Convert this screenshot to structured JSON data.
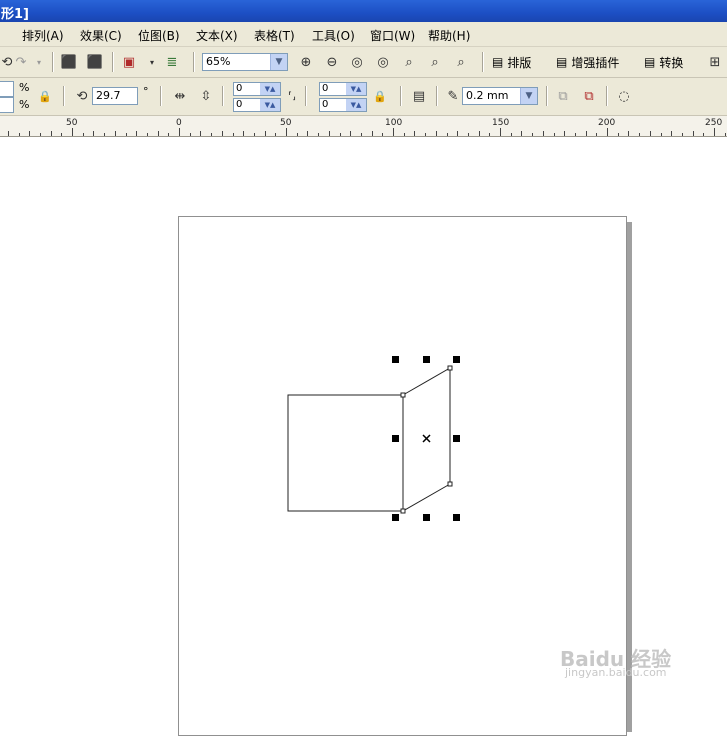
{
  "window": {
    "title": "形1]"
  },
  "menu": [
    {
      "label": "排列(A)"
    },
    {
      "label": "效果(C)"
    },
    {
      "label": "位图(B)"
    },
    {
      "label": "文本(X)"
    },
    {
      "label": "表格(T)"
    },
    {
      "label": "工具(O)"
    },
    {
      "label": "窗口(W)"
    },
    {
      "label": "帮助(H)"
    }
  ],
  "toolbar": {
    "zoom_value": "65%",
    "buttons": [
      {
        "label": "排版"
      },
      {
        "label": "增强插件"
      },
      {
        "label": "转换"
      }
    ]
  },
  "property_bar": {
    "percent_symbol": "%",
    "rotation_value": "29.7",
    "degree_symbol": "°",
    "skew_h": "0",
    "skew_v": "0",
    "size_x": "0",
    "size_y": "0",
    "outline_width": "0.2 mm"
  },
  "ruler": {
    "labels": [
      "50",
      "0",
      "50",
      "100",
      "150",
      "200",
      "250"
    ]
  },
  "watermark": {
    "text": "Baidu 经验",
    "sub": "jingyan.baidu.com"
  }
}
